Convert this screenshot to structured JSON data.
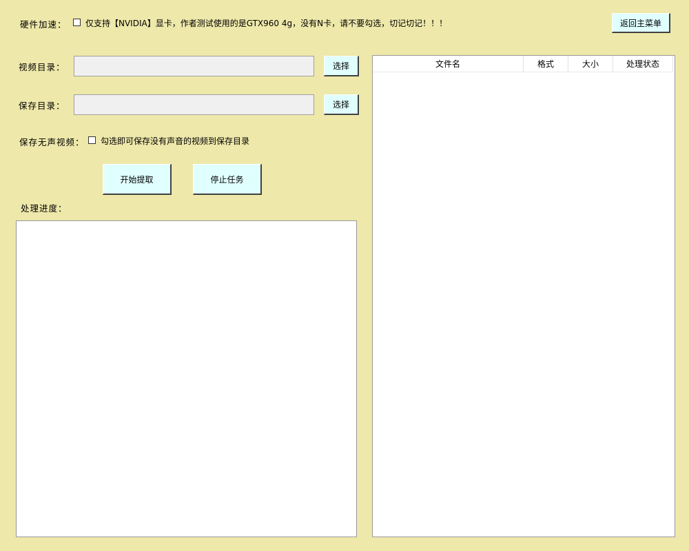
{
  "hw_accel": {
    "label": "硬件加速：",
    "checkbox_text": "仅支持【NVIDIA】显卡，作者测试使用的是GTX960 4g，没有N卡，请不要勾选，切记切记！！！",
    "checked": false
  },
  "back_button": {
    "label": "返回主菜单"
  },
  "video_dir": {
    "label": "视频目录：",
    "value": "",
    "button": "选择"
  },
  "save_dir": {
    "label": "保存目录：",
    "value": "",
    "button": "选择"
  },
  "silent": {
    "label": "保存无声视频：",
    "checkbox_text": "勾选即可保存没有声音的视频到保存目录",
    "checked": false
  },
  "actions": {
    "start": "开始提取",
    "stop": "停止任务"
  },
  "progress": {
    "label": "处理进度：",
    "text": ""
  },
  "file_table": {
    "columns": [
      {
        "label": "文件名"
      },
      {
        "label": "格式"
      },
      {
        "label": "大小"
      },
      {
        "label": "处理状态"
      }
    ],
    "rows": []
  },
  "colors": {
    "background": "#EEE8AA",
    "button": "#E0FFFF",
    "entry": "#F0F0F0"
  }
}
